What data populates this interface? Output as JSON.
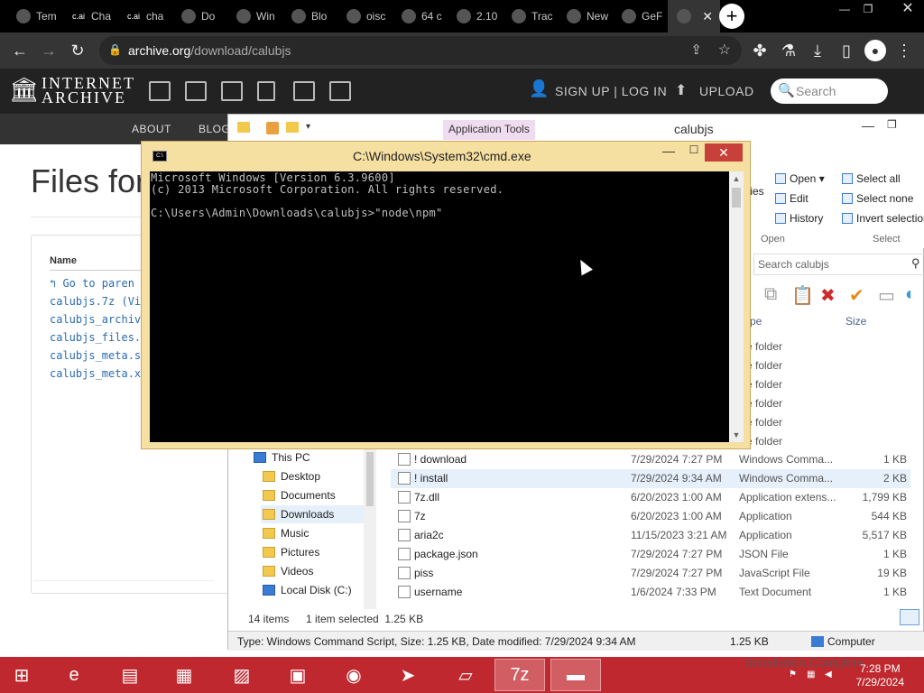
{
  "browser": {
    "tabs": [
      {
        "label": "Tem",
        "icon": "chatgpt-icon"
      },
      {
        "label": "Cha",
        "icon": "character-ai-icon",
        "badge": "c.ai"
      },
      {
        "label": "cha",
        "icon": "character-ai-icon",
        "badge": "c.ai"
      },
      {
        "label": "Do",
        "icon": "download-icon"
      },
      {
        "label": "Win",
        "icon": "image-icon"
      },
      {
        "label": "Blo",
        "icon": "globe-icon"
      },
      {
        "label": "oisc",
        "icon": "globe-icon"
      },
      {
        "label": "64 c",
        "icon": "avatar-icon"
      },
      {
        "label": "2.10",
        "icon": "cloud-icon"
      },
      {
        "label": "Trac",
        "icon": "x-icon"
      },
      {
        "label": "New",
        "icon": "chrome-icon"
      },
      {
        "label": "GeF",
        "icon": "nvidia-icon"
      },
      {
        "label": "",
        "icon": "archive-icon",
        "active": true
      }
    ],
    "url": "archive.org",
    "url_path": "/download/calubjs",
    "window_controls": [
      "—",
      "❐",
      "✕"
    ]
  },
  "ia": {
    "logo_line1": "INTERNET",
    "logo_line2": "ARCHIVE",
    "signup": "SIGN UP | LOG IN",
    "upload": "UPLOAD",
    "search_placeholder": "Search",
    "nav": [
      "ABOUT",
      "BLOG"
    ],
    "files_title": "Files for",
    "name_col": "Name",
    "files": [
      "Go to paren",
      "calubjs.7z (Vi",
      "calubjs_archiv",
      "calubjs_files.",
      "calubjs_meta.s",
      "calubjs_meta.x"
    ]
  },
  "explorer": {
    "app_tools": "Application Tools",
    "title": "calubjs",
    "ribbon": {
      "open": "Open ▾",
      "edit": "Edit",
      "history": "History",
      "select_all": "Select all",
      "select_none": "Select none",
      "invert": "Invert selection",
      "props": "ties",
      "group_open": "Open",
      "group_select": "Select"
    },
    "search_placeholder": "Search calubjs",
    "col_type": "pe",
    "col_size": "Size",
    "folder_types": [
      "e folder",
      "e folder",
      "e folder",
      "e folder",
      "e folder",
      "e folder"
    ],
    "nav": [
      {
        "label": "This PC",
        "icon": "computer-icon"
      },
      {
        "label": "Desktop",
        "icon": "folder-icon"
      },
      {
        "label": "Documents",
        "icon": "folder-icon"
      },
      {
        "label": "Downloads",
        "icon": "folder-icon",
        "selected": true
      },
      {
        "label": "Music",
        "icon": "folder-icon"
      },
      {
        "label": "Pictures",
        "icon": "folder-icon"
      },
      {
        "label": "Videos",
        "icon": "folder-icon"
      },
      {
        "label": "Local Disk (C:)",
        "icon": "drive-icon"
      }
    ],
    "files": [
      {
        "name": "! download",
        "date": "7/29/2024 7:27 PM",
        "type": "Windows Comma...",
        "size": "1 KB"
      },
      {
        "name": "! install",
        "date": "7/29/2024 9:34 AM",
        "type": "Windows Comma...",
        "size": "2 KB",
        "selected": true
      },
      {
        "name": "7z.dll",
        "date": "6/20/2023 1:00 AM",
        "type": "Application extens...",
        "size": "1,799 KB"
      },
      {
        "name": "7z",
        "date": "6/20/2023 1:00 AM",
        "type": "Application",
        "size": "544 KB"
      },
      {
        "name": "aria2c",
        "date": "11/15/2023 3:21 AM",
        "type": "Application",
        "size": "5,517 KB"
      },
      {
        "name": "package.json",
        "date": "7/29/2024 7:27 PM",
        "type": "JSON File",
        "size": "1 KB"
      },
      {
        "name": "piss",
        "date": "7/29/2024 7:27 PM",
        "type": "JavaScript File",
        "size": "19 KB"
      },
      {
        "name": "username",
        "date": "1/6/2024 7:33 PM",
        "type": "Text Document",
        "size": "1 KB"
      }
    ],
    "status_items": "14 items",
    "status_selected": "1 item selected  1.25 KB",
    "details": "Type: Windows Command Script, Size: 1.25 KB, Date modified: 7/29/2024 9:34 AM",
    "details_size": "1.25 KB",
    "details_location": "Computer"
  },
  "cmd": {
    "title": "C:\\Windows\\System32\\cmd.exe",
    "lines": [
      "Microsoft Windows [Version 6.3.9600]",
      "(c) 2013 Microsoft Corporation. All rights reserved.",
      "",
      "C:\\Users\\Admin\\Downloads\\calubjs>\"node\\npm\""
    ]
  },
  "taskbar": {
    "apps": [
      "start-icon",
      "ie-icon",
      "explorer-icon",
      "store-icon",
      "perfmon-icon",
      "app-icon",
      "chrome-icon",
      "adobe-icon",
      "notepad-icon",
      "7zip-icon",
      "cmd-icon"
    ],
    "time": "7:28 PM",
    "date": "7/29/2024",
    "toast": "Installation Complete"
  },
  "colors": {
    "taskbar": "#c0282f",
    "cmd_frame": "#f5dfa1",
    "ia_header": "#222222",
    "link": "#2a6cb0"
  }
}
